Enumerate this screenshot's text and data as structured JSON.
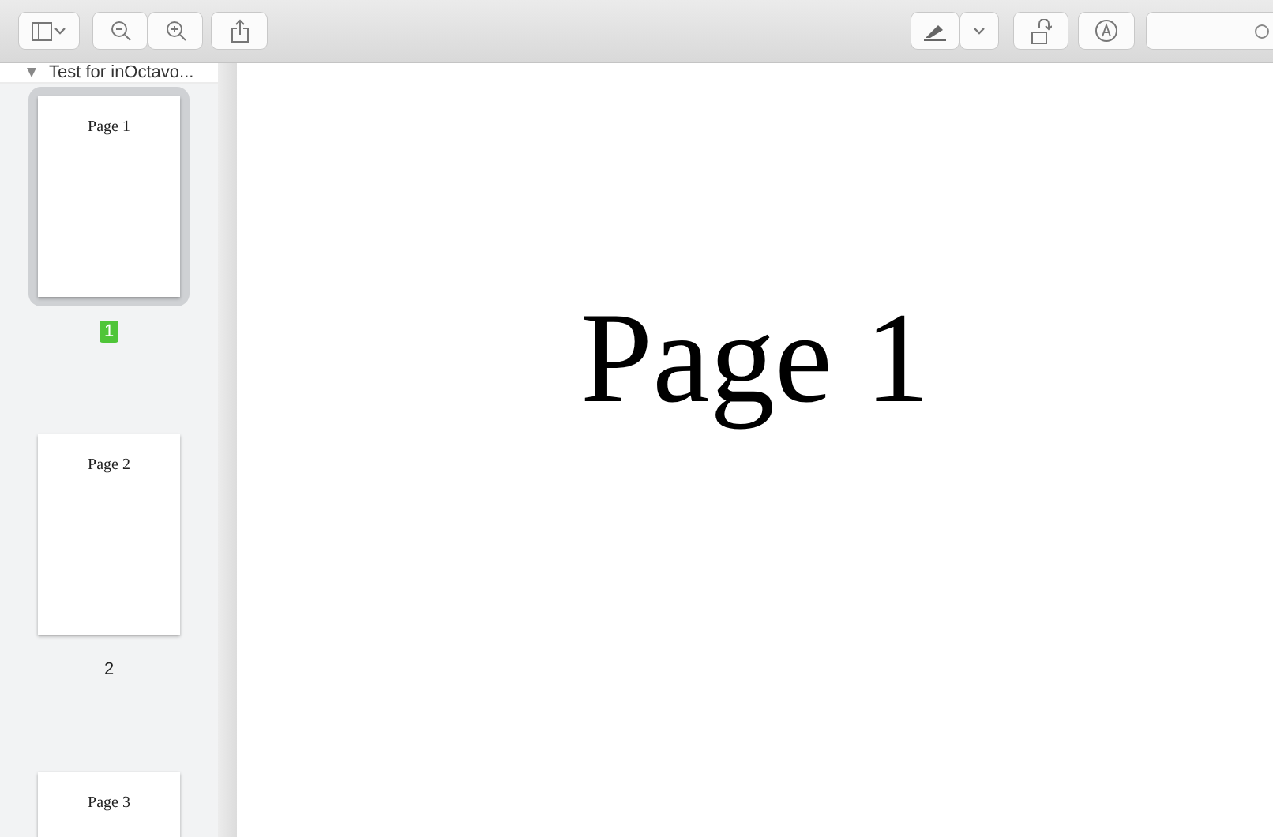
{
  "sidebar": {
    "document": {
      "title": "Test for inOctavo...",
      "expanded": true
    },
    "pages": [
      {
        "thumb_text": "Page 1",
        "label": "1",
        "selected": true
      },
      {
        "thumb_text": "Page 2",
        "label": "2",
        "selected": false
      },
      {
        "thumb_text": "Page 3",
        "selected": false
      }
    ]
  },
  "document_page": {
    "text": "Page 1"
  }
}
